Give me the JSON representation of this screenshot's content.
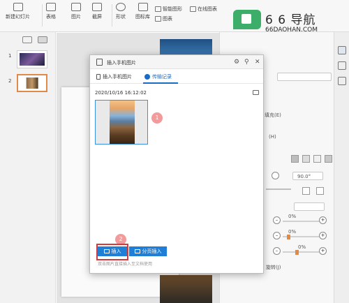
{
  "toolbar": {
    "new_slide": "新建幻灯片",
    "table": "表格",
    "picture": "图片",
    "screenshot": "截屏",
    "shape": "形状",
    "icon_library": "图标库",
    "smart_graphic": "智能图形",
    "online_chart": "在线图表",
    "chart": "图表"
  },
  "slides_panel": {
    "slides": [
      {
        "number": "1"
      },
      {
        "number": "2"
      }
    ]
  },
  "dialog": {
    "title": "插入手机图片",
    "tabs": [
      {
        "label": "插入手机图片"
      },
      {
        "label": "传输记录"
      }
    ],
    "timestamp": "2020/10/16 16:12:02",
    "insert_button": "插入",
    "page_insert_button": "分页插入",
    "hint": "双击图片直接插入至文档使用",
    "step_badges": [
      "1",
      "2"
    ]
  },
  "right_panel": {
    "fill_label_1": "填充(E)",
    "fill_label_2": "(H)",
    "angle": "90.0°",
    "percent_1": "0%",
    "percent_2": "0%",
    "percent_3": "0%",
    "bottom_label": "旋转(J)"
  },
  "watermark": {
    "title": "6 6 导航",
    "url": "66DAOHAN.COM"
  },
  "colors": {
    "accent_blue": "#1f7fd6",
    "highlight_red": "#d23b3b",
    "badge_pink": "#f39a9a",
    "selected_orange": "#e08a4a",
    "watermark_green": "#3cae6a"
  }
}
